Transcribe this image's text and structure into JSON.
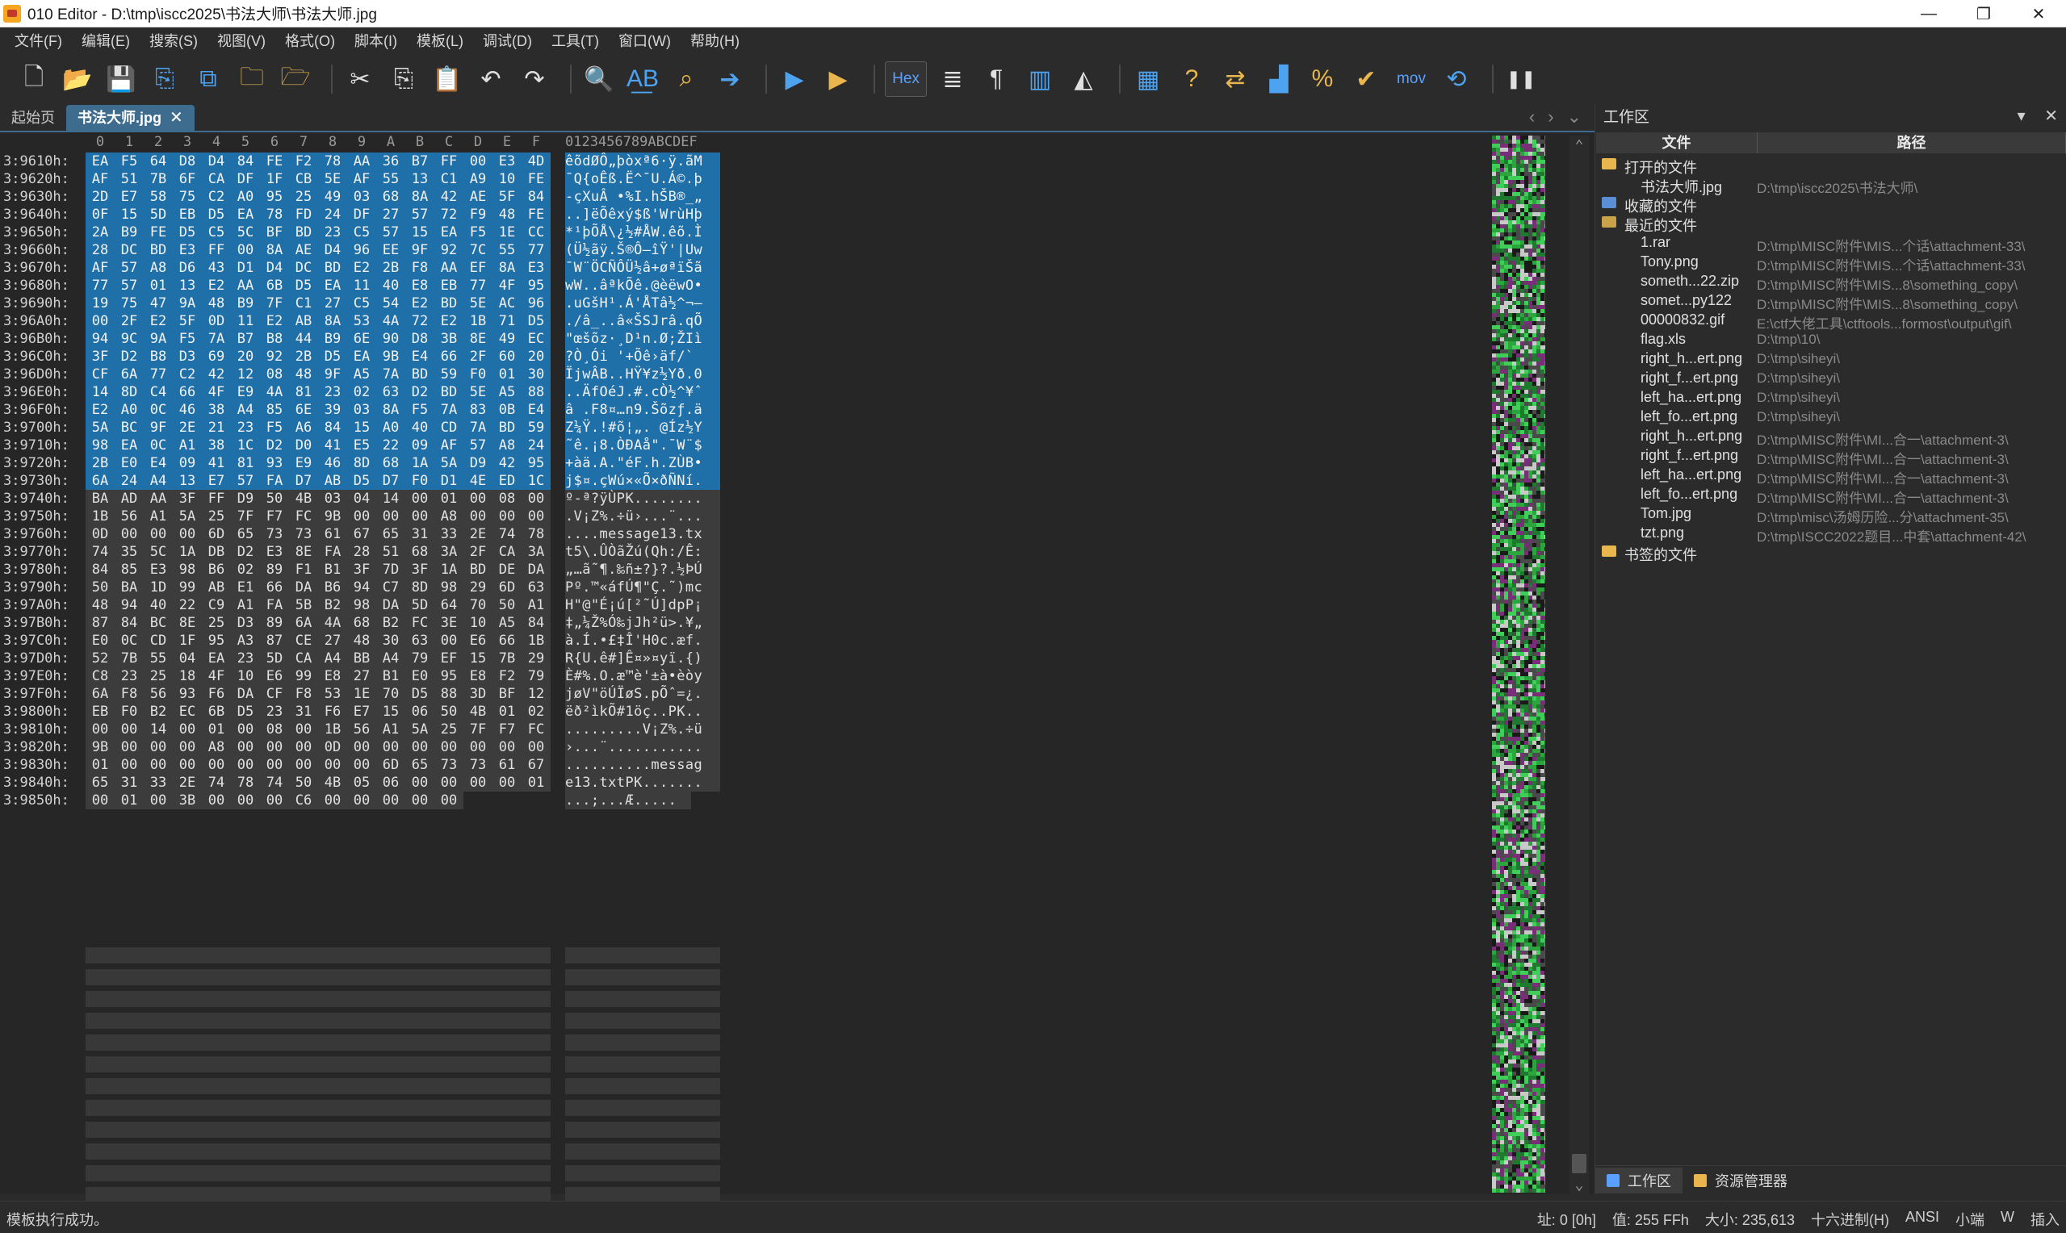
{
  "window": {
    "title": "010 Editor - D:\\tmp\\iscc2025\\书法大师\\书法大师.jpg",
    "controls": {
      "minimize": "—",
      "restore": "❐",
      "close": "✕"
    }
  },
  "menu": [
    "文件(F)",
    "编辑(E)",
    "搜索(S)",
    "视图(V)",
    "格式(O)",
    "脚本(I)",
    "模板(L)",
    "调试(D)",
    "工具(T)",
    "窗口(W)",
    "帮助(H)"
  ],
  "toolbar": {
    "hex_label": "Hex",
    "mov_label": "mov",
    "buttons": [
      "new-file-icon",
      "open-file-icon",
      "save-icon",
      "save-as-icon",
      "save-all-icon",
      "open-folder-icon",
      "open-project-icon",
      "cut-icon",
      "copy-icon",
      "paste-icon",
      "undo-icon",
      "redo-icon",
      "find-icon",
      "replace-icon",
      "find-in-files-icon",
      "goto-icon",
      "run-script-icon",
      "run-template-icon",
      "hex-mode",
      "text-wrap-icon",
      "paragraph-icon",
      "columns-icon",
      "inspector-icon",
      "calculator-icon",
      "help-icon",
      "compare-icon",
      "histogram-icon",
      "checksum-icon",
      "validate-icon",
      "mov",
      "base-convert-icon",
      "pause-icon"
    ]
  },
  "tabs": {
    "start": "起始页",
    "file": "书法大师.jpg",
    "close": "✕"
  },
  "editor": {
    "columns": [
      "0",
      "1",
      "2",
      "3",
      "4",
      "5",
      "6",
      "7",
      "8",
      "9",
      "A",
      "B",
      "C",
      "D",
      "E",
      "F"
    ],
    "ascii_header": "0123456789ABCDEF",
    "rows": [
      {
        "addr": "3:9610h:",
        "hex": [
          "EA",
          "F5",
          "64",
          "D8",
          "D4",
          "84",
          "FE",
          "F2",
          "78",
          "AA",
          "36",
          "B7",
          "FF",
          "00",
          "E3",
          "4D"
        ],
        "ascii": "êõdØÔ„þòxª6·ÿ.ãM"
      },
      {
        "addr": "3:9620h:",
        "hex": [
          "AF",
          "51",
          "7B",
          "6F",
          "CA",
          "DF",
          "1F",
          "CB",
          "5E",
          "AF",
          "55",
          "13",
          "C1",
          "A9",
          "10",
          "FE"
        ],
        "ascii": "¯Q{oÊß.Ë^¯U.Á©.þ"
      },
      {
        "addr": "3:9630h:",
        "hex": [
          "2D",
          "E7",
          "58",
          "75",
          "C2",
          "A0",
          "95",
          "25",
          "49",
          "03",
          "68",
          "8A",
          "42",
          "AE",
          "5F",
          "84"
        ],
        "ascii": "-çXuÂ •%I.hŠB®_„"
      },
      {
        "addr": "3:9640h:",
        "hex": [
          "0F",
          "15",
          "5D",
          "EB",
          "D5",
          "EA",
          "78",
          "FD",
          "24",
          "DF",
          "27",
          "57",
          "72",
          "F9",
          "48",
          "FE"
        ],
        "ascii": "..]ëÕêxý$ß'WrùHþ"
      },
      {
        "addr": "3:9650h:",
        "hex": [
          "2A",
          "B9",
          "FE",
          "D5",
          "C5",
          "5C",
          "BF",
          "BD",
          "23",
          "C5",
          "57",
          "15",
          "EA",
          "F5",
          "1E",
          "CC"
        ],
        "ascii": "*¹þÕÅ\\¿½#ÅW.êõ.Ì"
      },
      {
        "addr": "3:9660h:",
        "hex": [
          "28",
          "DC",
          "BD",
          "E3",
          "FF",
          "00",
          "8A",
          "AE",
          "D4",
          "96",
          "EE",
          "9F",
          "92",
          "7C",
          "55",
          "77"
        ],
        "ascii": "(Ü½ãÿ.Š®Ô–îŸ'|Uw"
      },
      {
        "addr": "3:9670h:",
        "hex": [
          "AF",
          "57",
          "A8",
          "D6",
          "43",
          "D1",
          "D4",
          "DC",
          "BD",
          "E2",
          "2B",
          "F8",
          "AA",
          "EF",
          "8A",
          "E3"
        ],
        "ascii": "¯W¨ÖCÑÔÜ½â+øªïŠã"
      },
      {
        "addr": "3:9680h:",
        "hex": [
          "77",
          "57",
          "01",
          "13",
          "E2",
          "AA",
          "6B",
          "D5",
          "EA",
          "11",
          "40",
          "E8",
          "EB",
          "77",
          "4F",
          "95"
        ],
        "ascii": "wW..âªkÕê.@èëwO•"
      },
      {
        "addr": "3:9690h:",
        "hex": [
          "19",
          "75",
          "47",
          "9A",
          "48",
          "B9",
          "7F",
          "C1",
          "27",
          "C5",
          "54",
          "E2",
          "BD",
          "5E",
          "AC",
          "96"
        ],
        "ascii": ".uGšH¹.Á'ÅTâ½^¬–"
      },
      {
        "addr": "3:96A0h:",
        "hex": [
          "00",
          "2F",
          "E2",
          "5F",
          "0D",
          "11",
          "E2",
          "AB",
          "8A",
          "53",
          "4A",
          "72",
          "E2",
          "1B",
          "71",
          "D5"
        ],
        "ascii": "./â_..â«ŠSJrâ.qÕ"
      },
      {
        "addr": "3:96B0h:",
        "hex": [
          "94",
          "9C",
          "9A",
          "F5",
          "7A",
          "B7",
          "B8",
          "44",
          "B9",
          "6E",
          "90",
          "D8",
          "3B",
          "8E",
          "49",
          "EC"
        ],
        "ascii": "\"œšõz·¸D¹n.Ø;ŽIì"
      },
      {
        "addr": "3:96C0h:",
        "hex": [
          "3F",
          "D2",
          "B8",
          "D3",
          "69",
          "20",
          "92",
          "2B",
          "D5",
          "EA",
          "9B",
          "E4",
          "66",
          "2F",
          "60",
          "20"
        ],
        "ascii": "?Ò¸Ói '+Õê›äf/` "
      },
      {
        "addr": "3:96D0h:",
        "hex": [
          "CF",
          "6A",
          "77",
          "C2",
          "42",
          "12",
          "08",
          "48",
          "9F",
          "A5",
          "7A",
          "BD",
          "59",
          "F0",
          "01",
          "30"
        ],
        "ascii": "ÏjwÂB..HŸ¥z½Yð.0"
      },
      {
        "addr": "3:96E0h:",
        "hex": [
          "14",
          "8D",
          "C4",
          "66",
          "4F",
          "E9",
          "4A",
          "81",
          "23",
          "02",
          "63",
          "D2",
          "BD",
          "5E",
          "A5",
          "88"
        ],
        "ascii": "..ÄfOéJ.#.cÒ½^¥ˆ"
      },
      {
        "addr": "3:96F0h:",
        "hex": [
          "E2",
          "A0",
          "0C",
          "46",
          "38",
          "A4",
          "85",
          "6E",
          "39",
          "03",
          "8A",
          "F5",
          "7A",
          "83",
          "0B",
          "E4"
        ],
        "ascii": "â .F8¤…n9.Šõzƒ.ä"
      },
      {
        "addr": "3:9700h:",
        "hex": [
          "5A",
          "BC",
          "9F",
          "2E",
          "21",
          "23",
          "F5",
          "A6",
          "84",
          "15",
          "A0",
          "40",
          "CD",
          "7A",
          "BD",
          "59"
        ],
        "ascii": "Z¼Ÿ.!#õ¦„. @Íz½Y"
      },
      {
        "addr": "3:9710h:",
        "hex": [
          "98",
          "EA",
          "0C",
          "A1",
          "38",
          "1C",
          "D2",
          "D0",
          "41",
          "E5",
          "22",
          "09",
          "AF",
          "57",
          "A8",
          "24"
        ],
        "ascii": "˜ê.¡8.ÒÐAå\".¯W¨$"
      },
      {
        "addr": "3:9720h:",
        "hex": [
          "2B",
          "E0",
          "E4",
          "09",
          "41",
          "81",
          "93",
          "E9",
          "46",
          "8D",
          "68",
          "1A",
          "5A",
          "D9",
          "42",
          "95"
        ],
        "ascii": "+àä.A.\"éF.h.ZÙB•"
      },
      {
        "addr": "3:9730h:",
        "hex": [
          "6A",
          "24",
          "A4",
          "13",
          "E7",
          "57",
          "FA",
          "D7",
          "AB",
          "D5",
          "D7",
          "F0",
          "D1",
          "4E",
          "ED",
          "1C"
        ],
        "ascii": "j$¤.çWú×«Õ×ðÑNí."
      },
      {
        "addr": "3:9740h:",
        "hex": [
          "BA",
          "AD",
          "AA",
          "3F",
          "FF",
          "D9",
          "50",
          "4B",
          "03",
          "04",
          "14",
          "00",
          "01",
          "00",
          "08",
          "00"
        ],
        "ascii": "º-ª?ÿÙPK........"
      },
      {
        "addr": "3:9750h:",
        "hex": [
          "1B",
          "56",
          "A1",
          "5A",
          "25",
          "7F",
          "F7",
          "FC",
          "9B",
          "00",
          "00",
          "00",
          "A8",
          "00",
          "00",
          "00"
        ],
        "ascii": ".V¡Z%.÷ü›...¨..."
      },
      {
        "addr": "3:9760h:",
        "hex": [
          "0D",
          "00",
          "00",
          "00",
          "6D",
          "65",
          "73",
          "73",
          "61",
          "67",
          "65",
          "31",
          "33",
          "2E",
          "74",
          "78"
        ],
        "ascii": "....message13.tx"
      },
      {
        "addr": "3:9770h:",
        "hex": [
          "74",
          "35",
          "5C",
          "1A",
          "DB",
          "D2",
          "E3",
          "8E",
          "FA",
          "28",
          "51",
          "68",
          "3A",
          "2F",
          "CA",
          "3A"
        ],
        "ascii": "t5\\.ÛÒãŽú(Qh:/Ê:"
      },
      {
        "addr": "3:9780h:",
        "hex": [
          "84",
          "85",
          "E3",
          "98",
          "B6",
          "02",
          "89",
          "F1",
          "B1",
          "3F",
          "7D",
          "3F",
          "1A",
          "BD",
          "DE",
          "DA"
        ],
        "ascii": "„…ã˜¶.‰ñ±?}?.½ÞÚ"
      },
      {
        "addr": "3:9790h:",
        "hex": [
          "50",
          "BA",
          "1D",
          "99",
          "AB",
          "E1",
          "66",
          "DA",
          "B6",
          "94",
          "C7",
          "8D",
          "98",
          "29",
          "6D",
          "63"
        ],
        "ascii": "Pº.™«áfÚ¶\"Ç.˜)mc"
      },
      {
        "addr": "3:97A0h:",
        "hex": [
          "48",
          "94",
          "40",
          "22",
          "C9",
          "A1",
          "FA",
          "5B",
          "B2",
          "98",
          "DA",
          "5D",
          "64",
          "70",
          "50",
          "A1"
        ],
        "ascii": "H\"@\"É¡ú[²˜Ú]dpP¡"
      },
      {
        "addr": "3:97B0h:",
        "hex": [
          "87",
          "84",
          "BC",
          "8E",
          "25",
          "D3",
          "89",
          "6A",
          "4A",
          "68",
          "B2",
          "FC",
          "3E",
          "10",
          "A5",
          "84"
        ],
        "ascii": "‡„¼Ž%Ó‰jJh²ü>.¥„"
      },
      {
        "addr": "3:97C0h:",
        "hex": [
          "E0",
          "0C",
          "CD",
          "1F",
          "95",
          "A3",
          "87",
          "CE",
          "27",
          "48",
          "30",
          "63",
          "00",
          "E6",
          "66",
          "1B"
        ],
        "ascii": "à.Í.•£‡Î'H0c.æf."
      },
      {
        "addr": "3:97D0h:",
        "hex": [
          "52",
          "7B",
          "55",
          "04",
          "EA",
          "23",
          "5D",
          "CA",
          "A4",
          "BB",
          "A4",
          "79",
          "EF",
          "15",
          "7B",
          "29"
        ],
        "ascii": "R{U.ê#]Ê¤»¤yï.{)"
      },
      {
        "addr": "3:97E0h:",
        "hex": [
          "C8",
          "23",
          "25",
          "18",
          "4F",
          "10",
          "E6",
          "99",
          "E8",
          "27",
          "B1",
          "E0",
          "95",
          "E8",
          "F2",
          "79"
        ],
        "ascii": "È#%.O.æ™è'±à•èòy"
      },
      {
        "addr": "3:97F0h:",
        "hex": [
          "6A",
          "F8",
          "56",
          "93",
          "F6",
          "DA",
          "CF",
          "F8",
          "53",
          "1E",
          "70",
          "D5",
          "88",
          "3D",
          "BF",
          "12"
        ],
        "ascii": "jøV\"öÚÏøS.pÕˆ=¿."
      },
      {
        "addr": "3:9800h:",
        "hex": [
          "EB",
          "F0",
          "B2",
          "EC",
          "6B",
          "D5",
          "23",
          "31",
          "F6",
          "E7",
          "15",
          "06",
          "50",
          "4B",
          "01",
          "02"
        ],
        "ascii": "ëð²ìkÕ#1öç..PK.."
      },
      {
        "addr": "3:9810h:",
        "hex": [
          "00",
          "00",
          "14",
          "00",
          "01",
          "00",
          "08",
          "00",
          "1B",
          "56",
          "A1",
          "5A",
          "25",
          "7F",
          "F7",
          "FC"
        ],
        "ascii": ".........V¡Z%.÷ü"
      },
      {
        "addr": "3:9820h:",
        "hex": [
          "9B",
          "00",
          "00",
          "00",
          "A8",
          "00",
          "00",
          "00",
          "0D",
          "00",
          "00",
          "00",
          "00",
          "00",
          "00",
          "00"
        ],
        "ascii": "›...¨..........."
      },
      {
        "addr": "3:9830h:",
        "hex": [
          "01",
          "00",
          "00",
          "00",
          "00",
          "00",
          "00",
          "00",
          "00",
          "00",
          "6D",
          "65",
          "73",
          "73",
          "61",
          "67"
        ],
        "ascii": "..........messag"
      },
      {
        "addr": "3:9840h:",
        "hex": [
          "65",
          "31",
          "33",
          "2E",
          "74",
          "78",
          "74",
          "50",
          "4B",
          "05",
          "06",
          "00",
          "00",
          "00",
          "00",
          "01"
        ],
        "ascii": "e13.txtPK......."
      },
      {
        "addr": "3:9850h:",
        "hex": [
          "00",
          "01",
          "00",
          "3B",
          "00",
          "00",
          "00",
          "C6",
          "00",
          "00",
          "00",
          "00",
          "00"
        ],
        "ascii": "...;...Æ....."
      }
    ]
  },
  "workspace": {
    "title": "工作区",
    "col_file": "文件",
    "col_path": "路径",
    "sections": {
      "open": "打开的文件",
      "favorites": "收藏的文件",
      "recent": "最近的文件",
      "bookmarks": "书签的文件"
    },
    "open_files": [
      {
        "name": "书法大师.jpg",
        "path": "D:\\tmp\\iscc2025\\书法大师\\"
      }
    ],
    "recent_files": [
      {
        "name": "1.rar",
        "path": "D:\\tmp\\MISC附件\\MIS...个话\\attachment-33\\"
      },
      {
        "name": "Tony.png",
        "path": "D:\\tmp\\MISC附件\\MIS...个话\\attachment-33\\"
      },
      {
        "name": "someth...22.zip",
        "path": "D:\\tmp\\MISC附件\\MIS...8\\something_copy\\"
      },
      {
        "name": "somet...py122",
        "path": "D:\\tmp\\MISC附件\\MIS...8\\something_copy\\"
      },
      {
        "name": "00000832.gif",
        "path": "E:\\ctf大佬工具\\ctftools...formost\\output\\gif\\"
      },
      {
        "name": "flag.xls",
        "path": "D:\\tmp\\10\\"
      },
      {
        "name": "right_h...ert.png",
        "path": "D:\\tmp\\siheyi\\"
      },
      {
        "name": "right_f...ert.png",
        "path": "D:\\tmp\\siheyi\\"
      },
      {
        "name": "left_ha...ert.png",
        "path": "D:\\tmp\\siheyi\\"
      },
      {
        "name": "left_fo...ert.png",
        "path": "D:\\tmp\\siheyi\\"
      },
      {
        "name": "right_h...ert.png",
        "path": "D:\\tmp\\MISC附件\\MI...合一\\attachment-3\\"
      },
      {
        "name": "right_f...ert.png",
        "path": "D:\\tmp\\MISC附件\\MI...合一\\attachment-3\\"
      },
      {
        "name": "left_ha...ert.png",
        "path": "D:\\tmp\\MISC附件\\MI...合一\\attachment-3\\"
      },
      {
        "name": "left_fo...ert.png",
        "path": "D:\\tmp\\MISC附件\\MI...合一\\attachment-3\\"
      },
      {
        "name": "Tom.jpg",
        "path": "D:\\tmp\\misc\\汤姆历险...分\\attachment-35\\"
      },
      {
        "name": "tzt.png",
        "path": "D:\\tmp\\ISCC2022题目...中套\\attachment-42\\"
      }
    ],
    "bottom_tabs": {
      "workspace": "工作区",
      "explorer": "资源管理器"
    }
  },
  "statusbar": {
    "message": "模板执行成功。",
    "address": "址: 0 [0h]",
    "value": "值: 255 FFh",
    "size": "大小: 235,613",
    "mode": "十六进制(H)",
    "encoding": "ANSI",
    "endian": "小端",
    "write": "W",
    "insert": "插入"
  },
  "colors": {
    "selection": "#1f6fa8",
    "highlight": "#8b1a1a",
    "background": "#262626",
    "accent": "#3d6c8f"
  }
}
